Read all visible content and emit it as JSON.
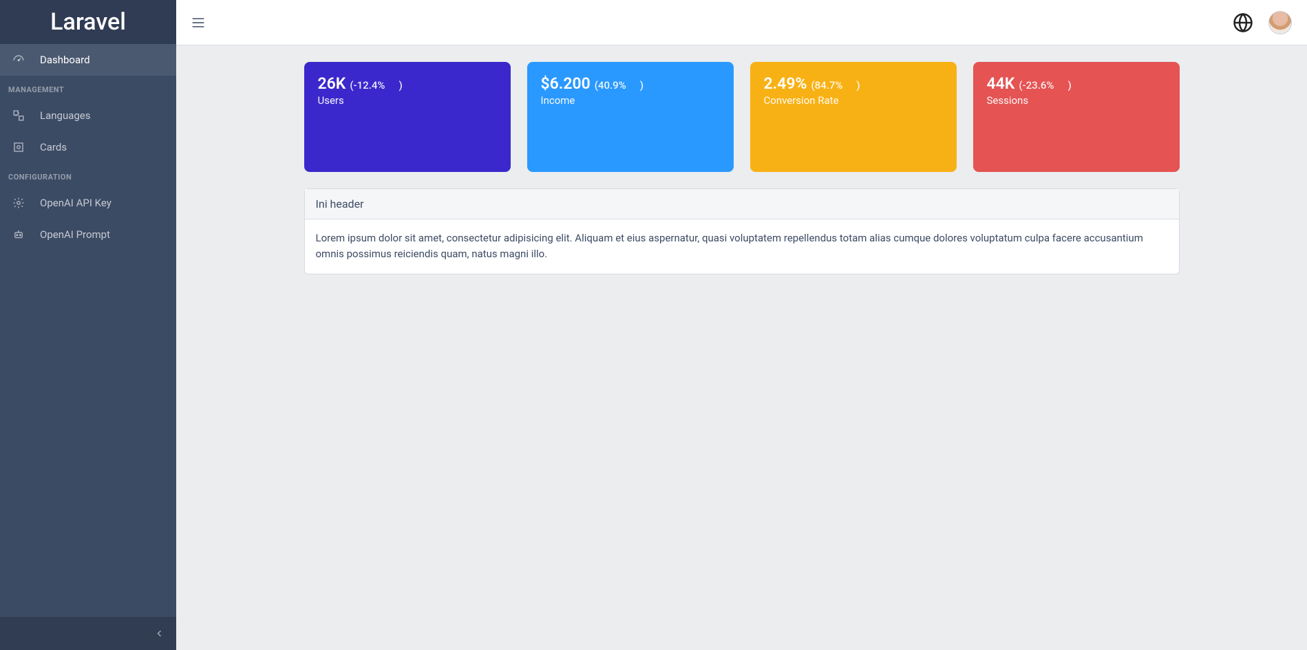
{
  "brand": "Laravel",
  "sidebar": {
    "items": [
      {
        "label": "Dashboard",
        "active": true
      },
      {
        "label": "Languages",
        "active": false
      },
      {
        "label": "Cards",
        "active": false
      },
      {
        "label": "OpenAI API Key",
        "active": false
      },
      {
        "label": "OpenAI Prompt",
        "active": false
      }
    ],
    "sections": {
      "management": "MANAGEMENT",
      "configuration": "CONFIGURATION"
    }
  },
  "widgets": [
    {
      "value": "26K",
      "delta": "(-12.4%",
      "close": ")",
      "label": "Users",
      "colorClass": "w-blue"
    },
    {
      "value": "$6.200",
      "delta": "(40.9%",
      "close": ")",
      "label": "Income",
      "colorClass": "w-sky"
    },
    {
      "value": "2.49%",
      "delta": "(84.7%",
      "close": ")",
      "label": "Conversion Rate",
      "colorClass": "w-yellow"
    },
    {
      "value": "44K",
      "delta": "(-23.6%",
      "close": ")",
      "label": "Sessions",
      "colorClass": "w-red"
    }
  ],
  "card": {
    "header": "Ini header",
    "body": "Lorem ipsum dolor sit amet, consectetur adipisicing elit. Aliquam et eius aspernatur, quasi voluptatem repellendus totam alias cumque dolores voluptatum culpa facere accusantium omnis possimus reiciendis quam, natus magni illo."
  }
}
